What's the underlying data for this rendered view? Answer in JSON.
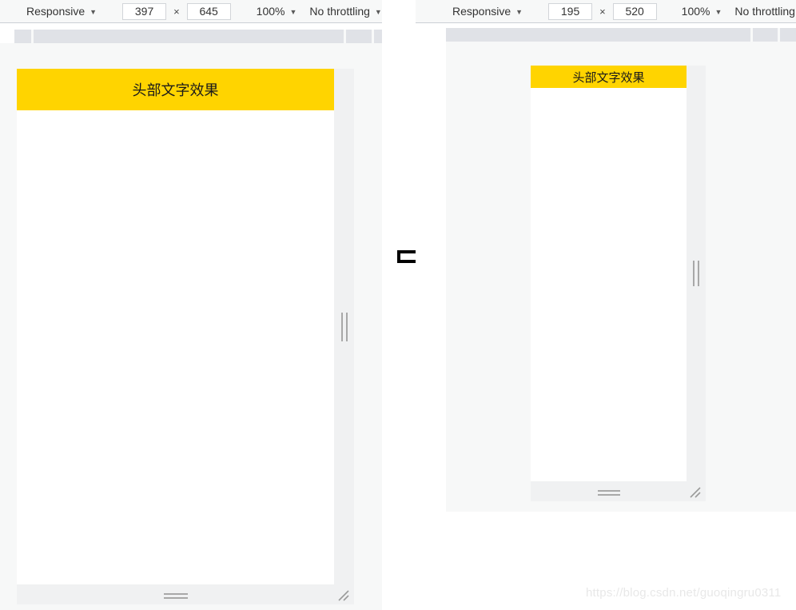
{
  "panels": [
    {
      "id": "left",
      "toolbar": {
        "device_label": "Responsive",
        "width_value": "397",
        "height_value": "645",
        "width_placeholder": "width",
        "height_placeholder": "height",
        "dimension_separator": "×",
        "zoom_label": "100%",
        "throttling_label": "No throttling",
        "caret": "▼"
      },
      "device_page": {
        "header_text": "头部文字效果",
        "header_bg": "#FFD400",
        "header_font_size": "18px",
        "body_bg": "#ffffff"
      }
    },
    {
      "id": "right",
      "toolbar": {
        "device_label": "Responsive",
        "width_value": "195",
        "height_value": "520",
        "width_placeholder": "width",
        "height_placeholder": "height",
        "dimension_separator": "×",
        "zoom_label": "100%",
        "throttling_label": "No throttling",
        "caret": "▼"
      },
      "device_page": {
        "header_text": "头部文字效果",
        "header_bg": "#FFD400",
        "header_font_size": "15px",
        "body_bg": "#ffffff"
      }
    }
  ],
  "flow": {
    "arrow_direction": "right",
    "arrow_color": "#000000"
  },
  "watermark": {
    "text": "https://blog.csdn.net/guoqingru0311",
    "color": "#e8e8e8"
  },
  "colors": {
    "accent_yellow": "#FFD400",
    "toolbar_bg": "#f7f8f8",
    "stage_bg": "#f7f8f8",
    "ruler_bg": "#e0e2e7",
    "handle_bg": "#f0f1f2",
    "handle_line": "#a8a8a8"
  }
}
